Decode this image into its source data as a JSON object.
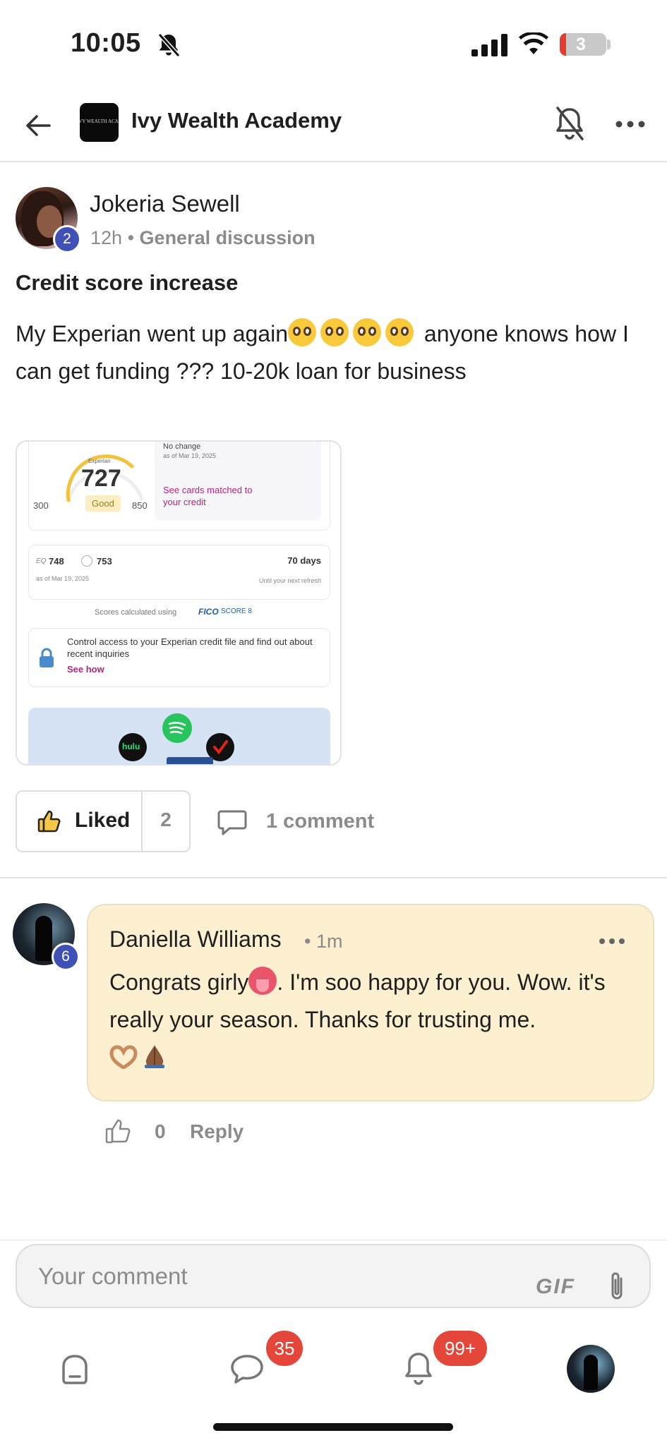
{
  "status_bar": {
    "time": "10:05",
    "battery": "3"
  },
  "header": {
    "group_name": "Ivy Wealth Academy",
    "group_logo_text": "IVY WEALTH ACADEMY"
  },
  "post": {
    "author": "Jokeria Sewell",
    "author_level": "2",
    "age": "12h",
    "separator": "•",
    "category": "General discussion",
    "title": "Credit score increase",
    "body_part1": "My Experian went up again",
    "body_part2": " anyone knows how I can get funding ??? 10-20k loan for business",
    "image": {
      "bureau": "Experian",
      "score": "727",
      "rating": "Good",
      "range_min": "300",
      "range_max": "850",
      "change_label": "No change",
      "change_date": "as of Mar 19, 2025",
      "cards_link": "See cards matched to your credit",
      "equifax_score": "748",
      "transunion_score": "753",
      "scores_date": "as of Mar 19, 2025",
      "refresh_days": "70 days",
      "refresh_label": "Until your next refresh",
      "fico_note": "Scores calculated using",
      "fico_brand": "FICO",
      "fico_model": "SCORE 8",
      "lock_text": "Control access to your Experian credit file and find out about recent inquiries",
      "lock_link": "See how",
      "hulu_label": "hulu"
    },
    "like_label": "Liked",
    "like_count": "2",
    "comment_label": "1 comment"
  },
  "comment": {
    "author": "Daniella Williams",
    "author_level": "6",
    "separator": "•",
    "age": "1m",
    "text_part1": "Congrats girly",
    "text_part2": ". I'm soo happy for you. Wow. it's really your season. Thanks for trusting me.",
    "like_count": "0",
    "reply_label": "Reply"
  },
  "composer": {
    "placeholder": "Your comment",
    "gif_label": "GIF"
  },
  "nav": {
    "chats_badge": "35",
    "notifications_badge": "99+"
  },
  "colors": {
    "accent_badge": "#3f51b5",
    "notification_red": "#e4473a",
    "comment_bubble": "#fcf0d1",
    "experian_magenta": "#b5247a"
  }
}
